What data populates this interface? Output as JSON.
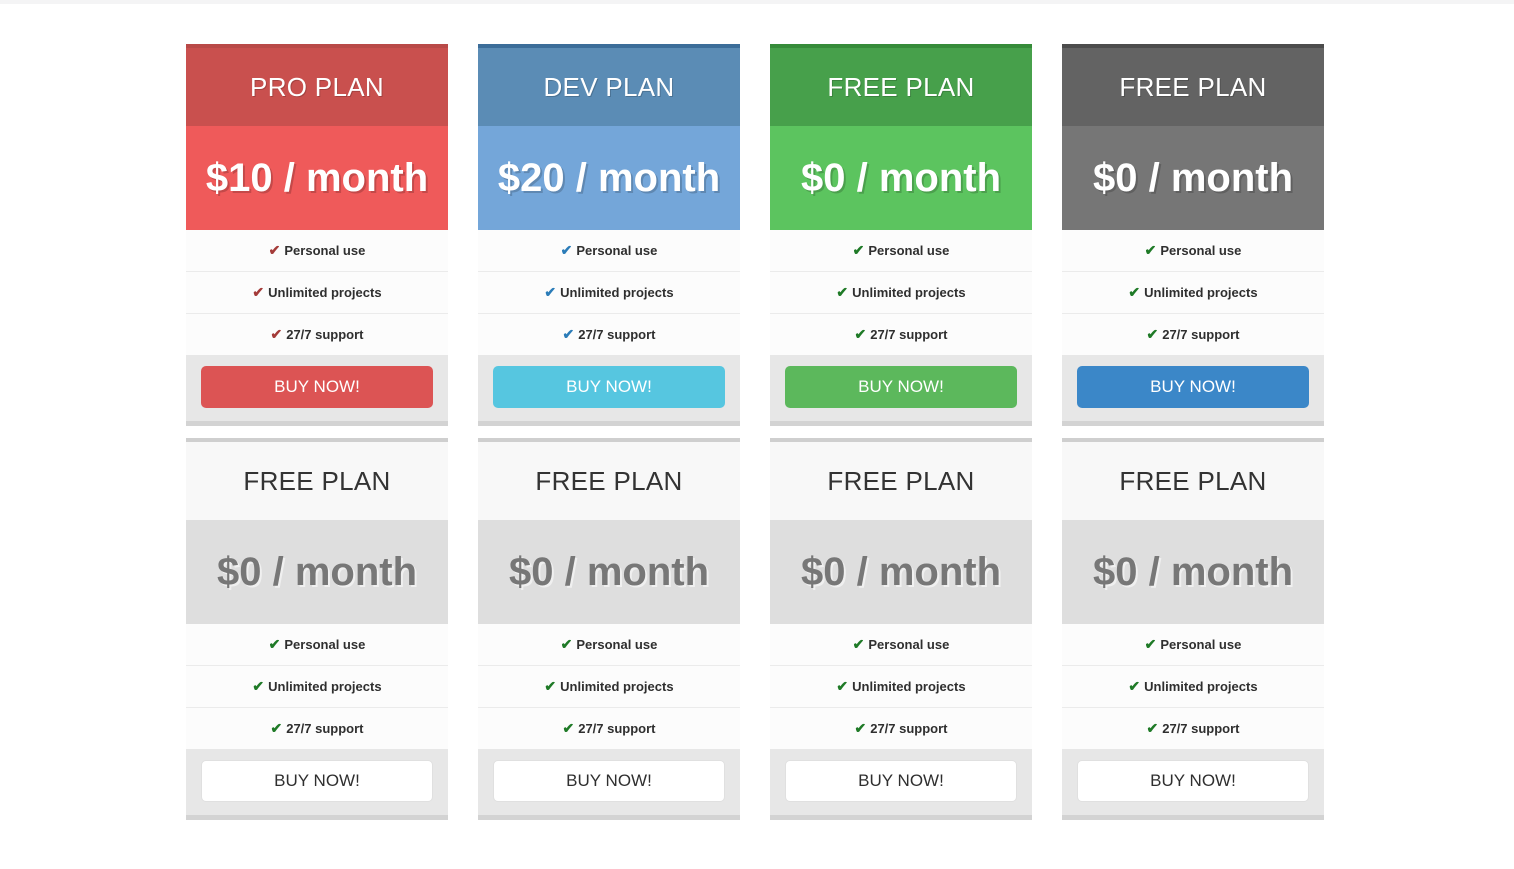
{
  "page": {
    "background": "#ffffff",
    "check_glyph": "✔"
  },
  "theme_colors": {
    "red": "#ef5a5a",
    "blue": "#74a6d9",
    "green": "#5cc45f",
    "dark": "#767676",
    "default": "#dedede",
    "red_button": "#dc5454",
    "blue_button": "#56c6e0",
    "green_button": "#5cb85c",
    "dark_button": "#3b87c8",
    "default_button": "#ffffff"
  },
  "rows": [
    {
      "cards": [
        {
          "title": "PRO PLAN",
          "price": "$10 / month",
          "features": [
            "Personal use",
            "Unlimited projects",
            "27/7 support"
          ],
          "button": "BUY NOW!"
        },
        {
          "title": "DEV PLAN",
          "price": "$20 / month",
          "features": [
            "Personal use",
            "Unlimited projects",
            "27/7 support"
          ],
          "button": "BUY NOW!"
        },
        {
          "title": "FREE PLAN",
          "price": "$0 / month",
          "features": [
            "Personal use",
            "Unlimited projects",
            "27/7 support"
          ],
          "button": "BUY NOW!"
        },
        {
          "title": "FREE PLAN",
          "price": "$0 / month",
          "features": [
            "Personal use",
            "Unlimited projects",
            "27/7 support"
          ],
          "button": "BUY NOW!"
        }
      ]
    },
    {
      "cards": [
        {
          "title": "FREE PLAN",
          "price": "$0 / month",
          "features": [
            "Personal use",
            "Unlimited projects",
            "27/7 support"
          ],
          "button": "BUY NOW!"
        },
        {
          "title": "FREE PLAN",
          "price": "$0 / month",
          "features": [
            "Personal use",
            "Unlimited projects",
            "27/7 support"
          ],
          "button": "BUY NOW!"
        },
        {
          "title": "FREE PLAN",
          "price": "$0 / month",
          "features": [
            "Personal use",
            "Unlimited projects",
            "27/7 support"
          ],
          "button": "BUY NOW!"
        },
        {
          "title": "FREE PLAN",
          "price": "$0 / month",
          "features": [
            "Personal use",
            "Unlimited projects",
            "27/7 support"
          ],
          "button": "BUY NOW!"
        }
      ]
    }
  ]
}
